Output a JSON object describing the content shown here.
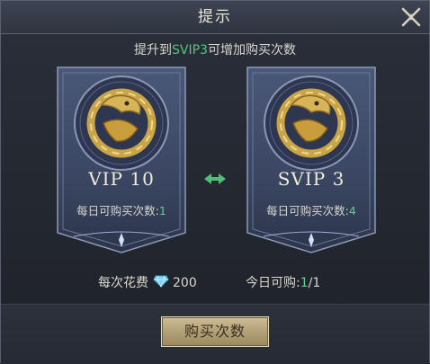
{
  "dialog": {
    "title": "提示",
    "subtitle_prefix": "提升到",
    "subtitle_highlight": "SVIP3",
    "subtitle_suffix": "可增加购买次数"
  },
  "current": {
    "vip_label": "VIP 10",
    "daily_prefix": "每日可购买次数:",
    "daily_value": "1"
  },
  "next": {
    "vip_label": "SVIP 3",
    "daily_prefix": "每日可购买次数:",
    "daily_value": "4"
  },
  "cost": {
    "label": "每次花费",
    "amount": "200",
    "currency_icon": "diamond-icon"
  },
  "today": {
    "label": "今日可购:",
    "used": "1",
    "total": "/1"
  },
  "buttons": {
    "buy_label": "购买次数",
    "close_icon": "close-icon"
  },
  "colors": {
    "highlight_green": "#54c77a",
    "gold": "#c9a54a",
    "button_gold": "#b09e74"
  }
}
